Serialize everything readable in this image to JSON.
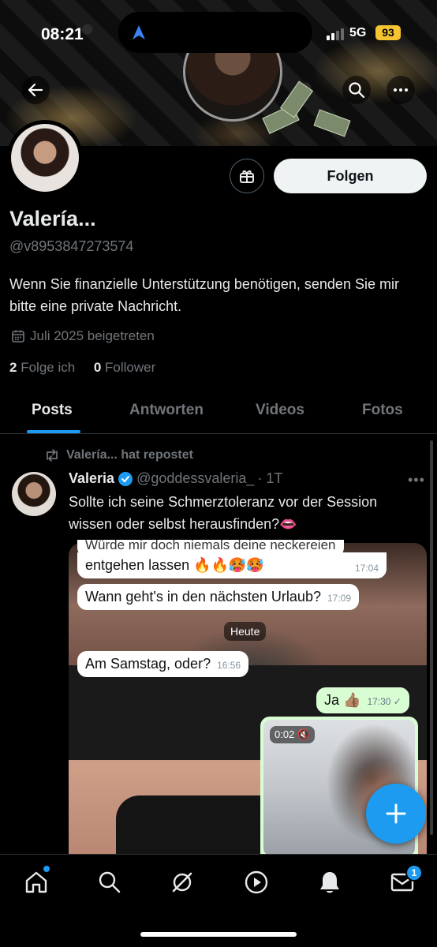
{
  "status_bar": {
    "time": "08:21",
    "network": "5G",
    "battery": "93"
  },
  "profile": {
    "follow_label": "Folgen",
    "display_name": "Valería...",
    "handle": "@v8953847273574",
    "bio": "Wenn Sie finanzielle Unterstützung benötigen, senden Sie mir bitte eine private Nachricht.",
    "joined": "Juli 2025 beigetreten",
    "following_count": "2",
    "following_label": "Folge ich",
    "followers_count": "0",
    "followers_label": "Follower"
  },
  "tabs": [
    {
      "label": "Posts",
      "active": true
    },
    {
      "label": "Antworten",
      "active": false
    },
    {
      "label": "Videos",
      "active": false
    },
    {
      "label": "Fotos",
      "active": false
    }
  ],
  "post": {
    "repost_label": "Valería... hat repostet",
    "author_name": "Valeria",
    "author_handle": "@goddessvaleria_",
    "time": "· 1T",
    "text": "Sollte ich seine Schmerztoleranz vor der Session wissen oder selbst herausfinden?👄",
    "chat": {
      "msg1_top": "Würde mir doch niemals deine neckereien",
      "msg1": "entgehen lassen 🔥🔥🥵🥵",
      "msg1_time": "17:04",
      "msg2": "Wann geht's in den nächsten Urlaub?",
      "msg2_time": "17:09",
      "day_chip": "Heute",
      "msg3": "Am Samstag, oder?",
      "msg3_time": "16:56",
      "msg4": "Ja 👍🏽",
      "msg4_time": "17:30 ✓",
      "video_duration": "0:02 🔇"
    }
  },
  "nav": {
    "messages_badge": "1"
  },
  "colors": {
    "accent": "#1d9bf0",
    "background": "#000000",
    "muted": "#71767b"
  }
}
